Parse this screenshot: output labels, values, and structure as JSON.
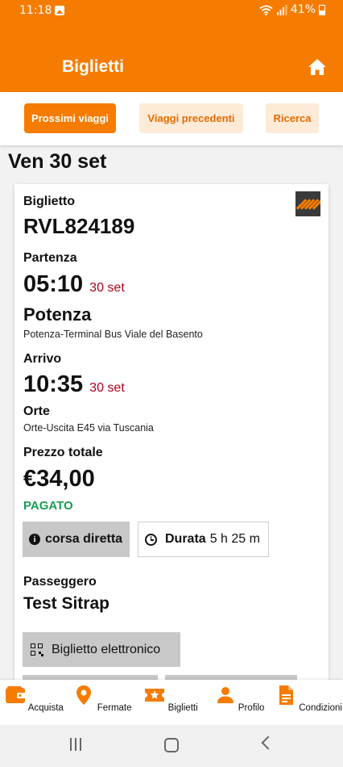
{
  "status_bar": {
    "time": "11:18",
    "battery": "41%"
  },
  "app_bar": {
    "title": "Biglietti"
  },
  "tabs": [
    {
      "label": "Prossimi viaggi",
      "active": true
    },
    {
      "label": "Viaggi precedenti",
      "active": false
    },
    {
      "label": "Ricerca",
      "active": false
    }
  ],
  "day_header": "Ven 30 set",
  "ticket": {
    "ticket_label": "Biglietto",
    "ticket_code": "RVL824189",
    "departure_label": "Partenza",
    "departure_time": "05:10",
    "departure_date": "30 set",
    "departure_city": "Potenza",
    "departure_stop": "Potenza-Terminal Bus Viale del Basento",
    "arrival_label": "Arrivo",
    "arrival_time": "10:35",
    "arrival_date": "30 set",
    "arrival_city": "Orte",
    "arrival_stop": "Orte-Uscita E45 via Tuscania",
    "price_label": "Prezzo totale",
    "price": "€34,00",
    "payment_status": "PAGATO",
    "direct_label": "corsa diretta",
    "duration_label": "Durata",
    "duration_value": "5 h 25 m",
    "passenger_label": "Passeggero",
    "passenger_name": "Test Sitrap",
    "eticket_button": "Biglietto elettronico"
  },
  "bottom_nav": [
    {
      "label": "Acquista",
      "icon": "wallet-icon"
    },
    {
      "label": "Fermate",
      "icon": "map-pin-icon"
    },
    {
      "label": "Biglietti",
      "icon": "ticket-star-icon"
    },
    {
      "label": "Profilo",
      "icon": "person-icon"
    },
    {
      "label": "Condizioni",
      "icon": "document-icon"
    }
  ],
  "colors": {
    "brand": "#f57c00",
    "tab_inactive_bg": "#fdebd7",
    "date_red": "#b0001a",
    "paid_green": "#1a9c55"
  }
}
